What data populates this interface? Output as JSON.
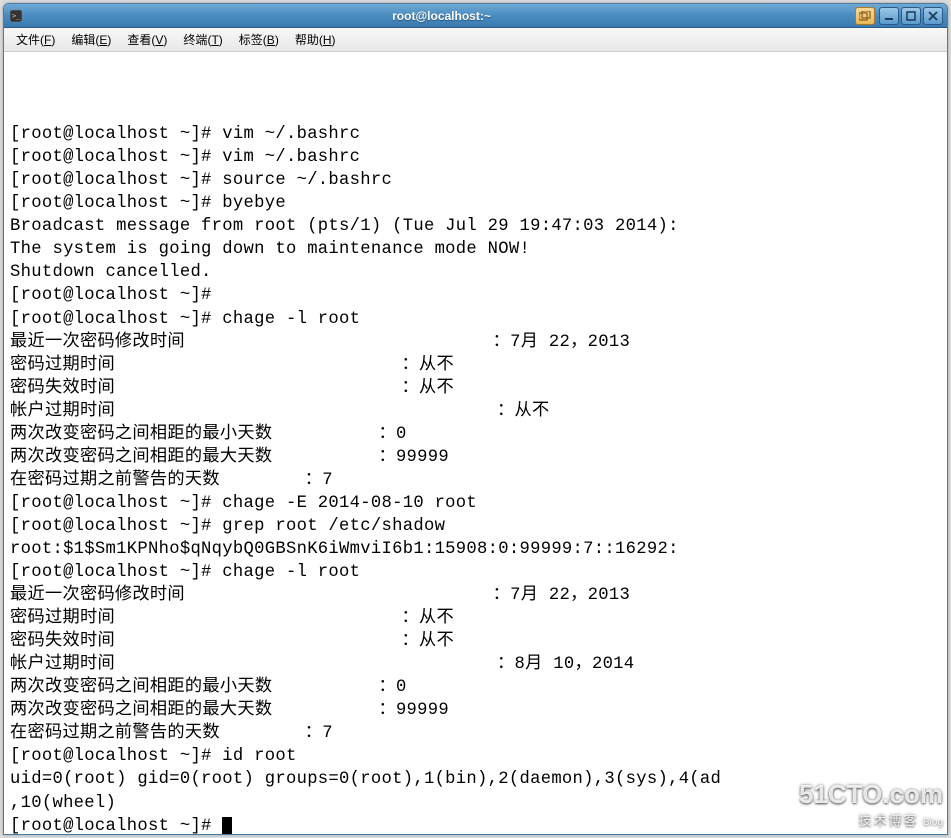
{
  "window": {
    "title": "root@localhost:~"
  },
  "menubar": {
    "items": [
      {
        "label": "文件",
        "accel": "F"
      },
      {
        "label": "编辑",
        "accel": "E"
      },
      {
        "label": "查看",
        "accel": "V"
      },
      {
        "label": "终端",
        "accel": "T"
      },
      {
        "label": "标签",
        "accel": "B"
      },
      {
        "label": "帮助",
        "accel": "H"
      }
    ]
  },
  "terminal": {
    "lines": [
      "[root@localhost ~]# vim ~/.bashrc",
      "[root@localhost ~]# vim ~/.bashrc",
      "[root@localhost ~]# source ~/.bashrc",
      "[root@localhost ~]# byebye",
      "",
      "Broadcast message from root (pts/1) (Tue Jul 29 19:47:03 2014):",
      "",
      "The system is going down to maintenance mode NOW!",
      "",
      "Shutdown cancelled.",
      "[root@localhost ~]# ",
      "[root@localhost ~]# chage -l root",
      "最近一次密码修改时间                             ：7月 22，2013",
      "密码过期时间                           ：从不",
      "密码失效时间                           ：从不",
      "帐户过期时间                                    ：从不",
      "两次改变密码之间相距的最小天数          ：0",
      "两次改变密码之间相距的最大天数          ：99999",
      "在密码过期之前警告的天数        ：7",
      "[root@localhost ~]# chage -E 2014-08-10 root",
      "[root@localhost ~]# grep root /etc/shadow",
      "root:$1$Sm1KPNho$qNqybQ0GBSnK6iWmviI6b1:15908:0:99999:7::16292:",
      "[root@localhost ~]# chage -l root",
      "最近一次密码修改时间                             ：7月 22，2013",
      "密码过期时间                           ：从不",
      "密码失效时间                           ：从不",
      "帐户过期时间                                    ：8月 10，2014",
      "两次改变密码之间相距的最小天数          ：0",
      "两次改变密码之间相距的最大天数          ：99999",
      "在密码过期之前警告的天数        ：7",
      "[root@localhost ~]# id root",
      "uid=0(root) gid=0(root) groups=0(root),1(bin),2(daemon),3(sys),4(ad",
      ",10(wheel)",
      "[root@localhost ~]# "
    ]
  },
  "watermark": {
    "big": "51CTO.com",
    "small": "技术博客",
    "tag": "Blog"
  }
}
